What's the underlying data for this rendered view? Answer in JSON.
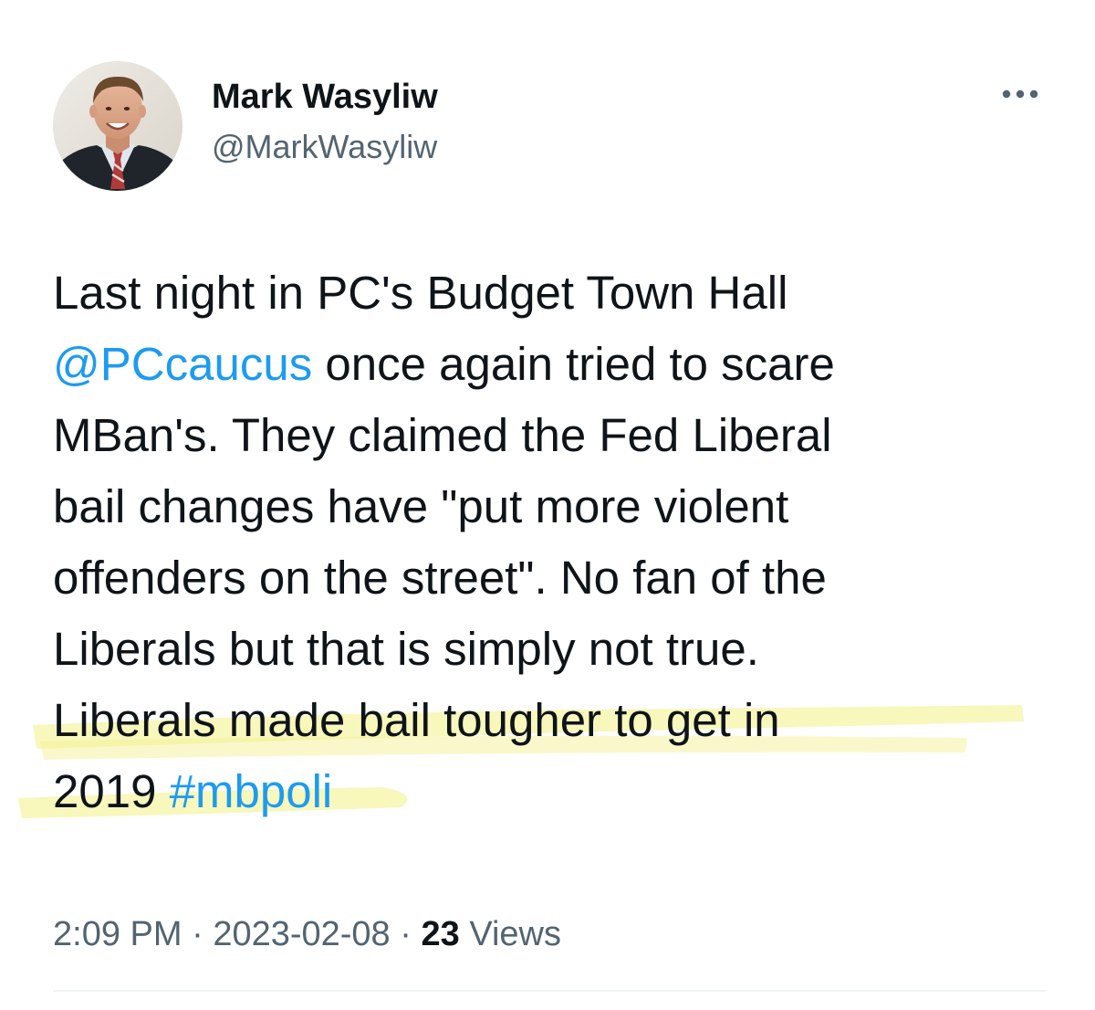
{
  "author": {
    "display_name": "Mark Wasyliw",
    "handle": "@MarkWasyliw",
    "avatar_icon": "profile-photo"
  },
  "more_icon": "ellipsis-icon",
  "tweet": {
    "lines": [
      [
        {
          "text": "Last night in PC's Budget Town Hall"
        }
      ],
      [
        {
          "text": "@PCcaucus",
          "type": "mention"
        },
        {
          "text": " once again tried to scare"
        }
      ],
      [
        {
          "text": "MBan's. They claimed the Fed Liberal"
        }
      ],
      [
        {
          "text": "bail changes have \"put more violent"
        }
      ],
      [
        {
          "text": "offenders on the street\". No fan of the"
        }
      ],
      [
        {
          "text": "Liberals but that is simply not  true."
        }
      ],
      [
        {
          "text": "Liberals made bail tougher to get in"
        }
      ],
      [
        {
          "text": "2019 "
        },
        {
          "text": "#mbpoli",
          "type": "hashtag"
        }
      ]
    ],
    "highlight_color": "#f6f4a6"
  },
  "meta": {
    "time": "2:09 PM",
    "separator": " · ",
    "date": "2023-02-08",
    "views_count": "23",
    "views_label": " Views"
  },
  "colors": {
    "link": "#1d9bf0",
    "secondary_text": "#536471",
    "primary_text": "#0f1419"
  }
}
